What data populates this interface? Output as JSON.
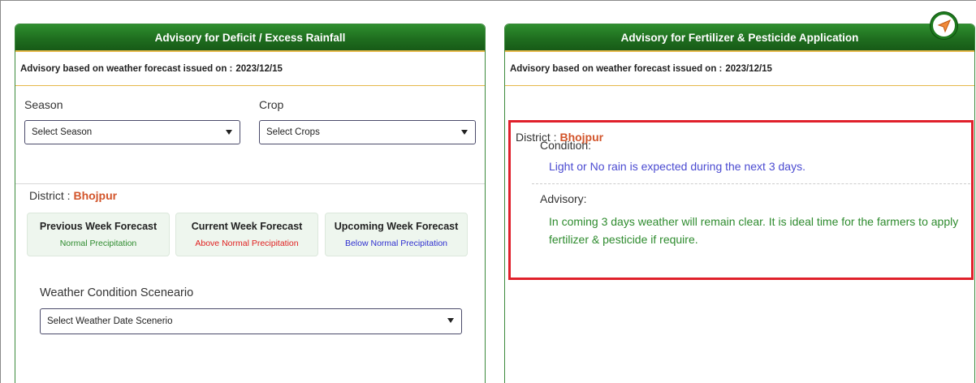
{
  "left_panel": {
    "title": "Advisory for Deficit / Excess Rainfall",
    "issued_label": "Advisory based on weather forecast issued on :",
    "issued_date": "2023/12/15",
    "season": {
      "label": "Season",
      "value": "Select Season"
    },
    "crop": {
      "label": "Crop",
      "value": "Select Crops"
    },
    "district_label": "District :",
    "district_name": "Bhojpur",
    "forecasts": [
      {
        "title": "Previous Week Forecast",
        "value": "Normal Precipitation",
        "color": "#2e8b2e"
      },
      {
        "title": "Current Week Forecast",
        "value": "Above Normal Precipitation",
        "color": "#e02020"
      },
      {
        "title": "Upcoming Week Forecast",
        "value": "Below Normal Precipitation",
        "color": "#2f2fd0"
      }
    ],
    "weather_scenario": {
      "label": "Weather Condition Sceneario",
      "value": "Select Weather Date Scenerio"
    }
  },
  "right_panel": {
    "title": "Advisory for Fertilizer & Pesticide Application",
    "issued_label": "Advisory based on weather forecast issued on :",
    "issued_date": "2023/12/15",
    "district_label": "District :",
    "district_name": "Bhojpur",
    "condition_label": "Condition:",
    "condition_text": "Light or No rain is expected during the next 3 days.",
    "advisory_label": "Advisory:",
    "advisory_text": "In coming 3 days weather will remain clear. It is ideal time for the farmers to apply fertilizer & pesticide if require."
  },
  "icons": {
    "compass": "navigation-compass-icon"
  },
  "colors": {
    "header_green": "#1f6e1f",
    "accent_gold": "#e6b84a",
    "district_orange": "#d2542a",
    "highlight_red": "#e0202b",
    "condition_blue": "#4b4bd1",
    "advisory_green": "#2e8b2e"
  }
}
